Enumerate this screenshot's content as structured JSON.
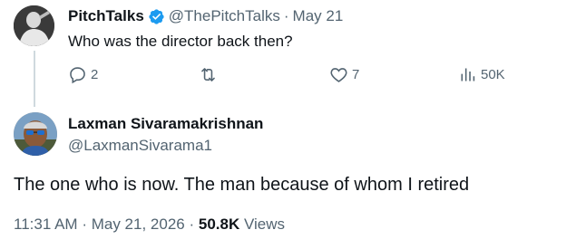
{
  "reply_parent": {
    "author_name": "PitchTalks",
    "author_handle": "@ThePitchTalks",
    "separator": "·",
    "date": "May 21",
    "text": "Who was the director back then?",
    "reply_count": "2",
    "like_count": "7",
    "view_count": "50K"
  },
  "main_tweet": {
    "author_name": "Laxman Sivaramakrishnan",
    "author_handle": "@LaxmanSivarama1",
    "text": "The one who is now. The man because of whom I retired",
    "time": "11:31 AM",
    "separator1": "·",
    "date": "May 21, 2026",
    "separator2": "·",
    "views_value": "50.8K",
    "views_label": "Views"
  },
  "colors": {
    "verified": "#1d9bf0",
    "secondary_text": "#536471",
    "primary_text": "#0f1419",
    "thread_line": "#cfd9de"
  }
}
